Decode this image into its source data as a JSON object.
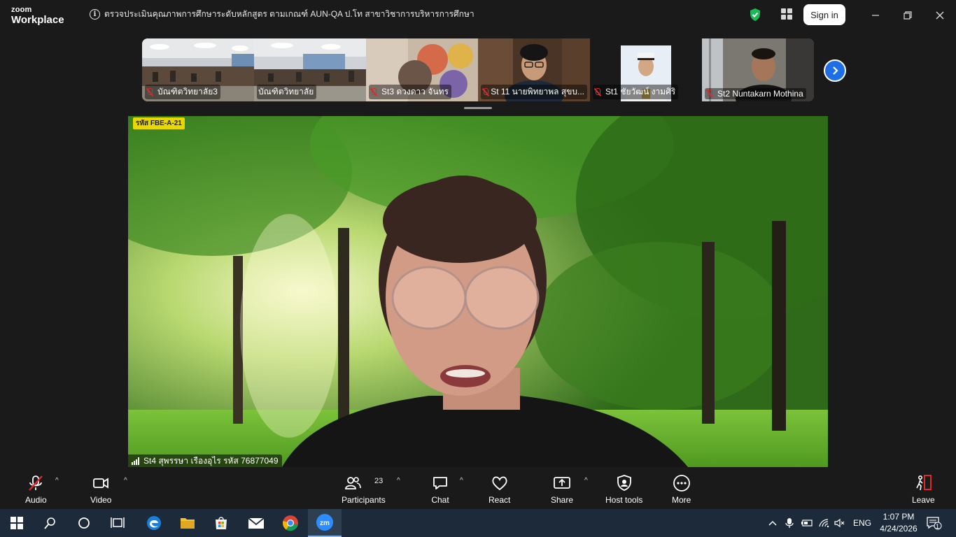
{
  "app": {
    "brand_top": "zoom",
    "brand_bottom": "Workplace"
  },
  "meeting": {
    "title": "ตรวจประเมินคุณภาพการศึกษาระดับหลักสูตร ตามเกณฑ์ AUN-QA ป.โท สาขาวิชาการบริหารการศึกษา"
  },
  "header": {
    "signin_label": "Sign in"
  },
  "thumbnails": [
    {
      "name": "บัณฑิตวิทยาลัย3",
      "muted": true
    },
    {
      "name": "บัณฑิตวิทยาลัย",
      "muted": false
    },
    {
      "name": "St3 ดวงดาว จันทร",
      "muted": true
    },
    {
      "name": "St 11 นายพิทยาพล สุขบ...",
      "muted": true
    },
    {
      "name": "St1 ชัยวัฒน์ งามศิริ",
      "muted": true
    },
    {
      "name": "St2 Nuntakarn Mothina",
      "muted": true
    }
  ],
  "main_video": {
    "tag": "รหัส FBE-A-21",
    "speaker": "St4 สุพรรษา เรืองอุไร รหัส 76877049"
  },
  "toolbar": {
    "audio": "Audio",
    "video": "Video",
    "participants": "Participants",
    "participants_count": "23",
    "chat": "Chat",
    "react": "React",
    "share": "Share",
    "host_tools": "Host tools",
    "more": "More",
    "leave": "Leave"
  },
  "taskbar": {
    "language": "ENG",
    "time": "1:07 PM",
    "date": "4/24/2026",
    "notification_count": "1"
  },
  "colors": {
    "accent": "#1e6fe6",
    "muted": "#e02828",
    "shield": "#1db954",
    "leave": "#e02828"
  }
}
